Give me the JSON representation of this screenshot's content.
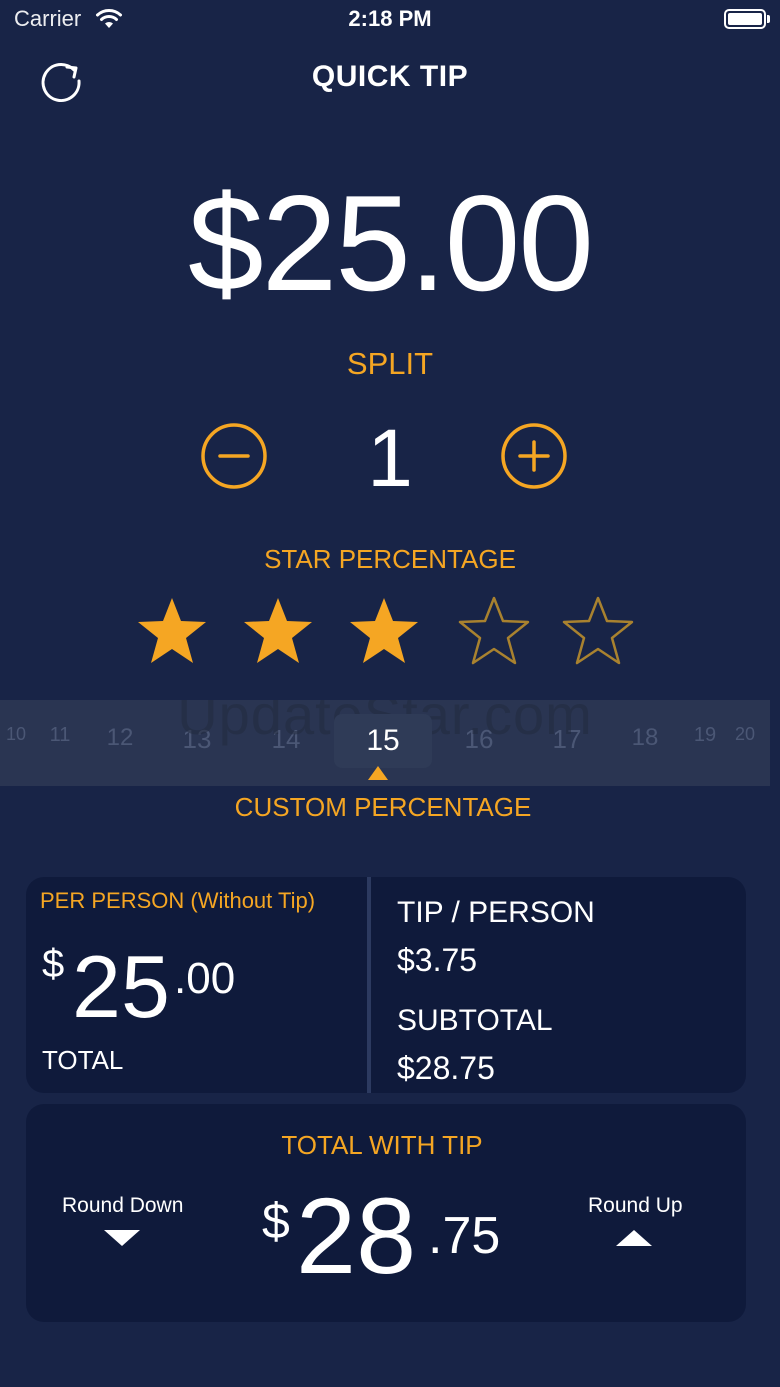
{
  "status_bar": {
    "carrier": "Carrier",
    "time": "2:18 PM"
  },
  "header": {
    "title": "QUICK TIP",
    "refresh_icon": "refresh-icon"
  },
  "bill": {
    "amount": "$25.00"
  },
  "split": {
    "label": "SPLIT",
    "value": "1",
    "minus_icon": "minus-circle-icon",
    "plus_icon": "plus-circle-icon"
  },
  "stars": {
    "label": "STAR PERCENTAGE",
    "rating": 3,
    "max": 5
  },
  "picker": {
    "watermark": "UpdateStar.com",
    "ticks": [
      "10",
      "11",
      "12",
      "13",
      "14",
      "16",
      "17",
      "18",
      "19",
      "20"
    ],
    "selected": "15",
    "label": "CUSTOM PERCENTAGE"
  },
  "summary": {
    "per_person_label": "PER PERSON (Without Tip)",
    "per_person_dollar": "$",
    "per_person_int": "25",
    "per_person_cents": ".00",
    "total_label": "TOTAL",
    "tip_label": "TIP / PERSON",
    "tip_value": "$3.75",
    "subtotal_label": "SUBTOTAL",
    "subtotal_value": "$28.75"
  },
  "total_with_tip": {
    "label": "TOTAL WITH TIP",
    "round_down": "Round Down",
    "round_up": "Round Up",
    "dollar": "$",
    "int": "28",
    "cents": ".75"
  },
  "colors": {
    "background": "#182447",
    "card": "#0f1a3b",
    "accent": "#f5a623",
    "text": "#ffffff"
  }
}
